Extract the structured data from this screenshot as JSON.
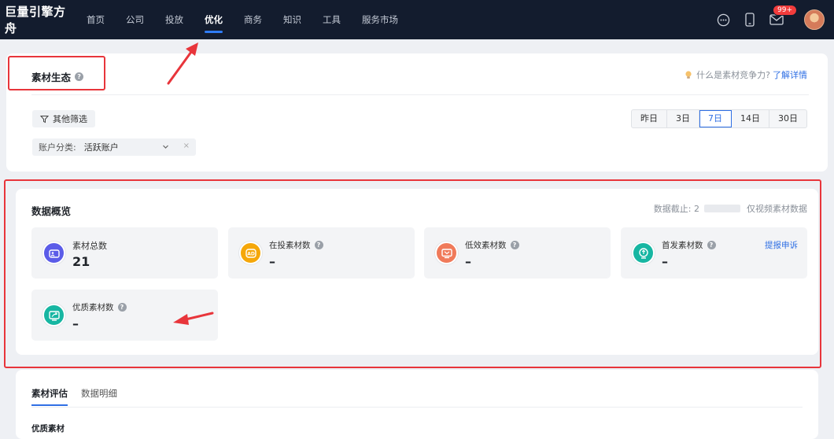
{
  "nav": {
    "brand": "巨量引擎方舟",
    "items": [
      {
        "label": "首页",
        "active": false
      },
      {
        "label": "公司",
        "active": false
      },
      {
        "label": "投放",
        "active": false
      },
      {
        "label": "优化",
        "active": true
      },
      {
        "label": "商务",
        "active": false
      },
      {
        "label": "知识",
        "active": false
      },
      {
        "label": "工具",
        "active": false
      },
      {
        "label": "服务市场",
        "active": false
      }
    ],
    "badge": "99+"
  },
  "ecology": {
    "title": "素材生态",
    "help_text": "什么是素材竞争力?",
    "help_link": "了解详情",
    "filter_button": "其他筛选",
    "account_label": "账户分类:",
    "account_value": "活跃账户",
    "clear": "×",
    "date_ranges": [
      "昨日",
      "3日",
      "7日",
      "14日",
      "30日"
    ],
    "active_range": "7日"
  },
  "overview": {
    "title": "数据概览",
    "cutoff_label": "数据截止: 2",
    "note": "仅视频素材数据",
    "stats": [
      {
        "name": "素材总数",
        "value": "21",
        "icon": "material-total-icon",
        "color": "#5b5ce8"
      },
      {
        "name": "在投素材数",
        "value": "–",
        "icon": "ad-icon",
        "color": "#f5a70a"
      },
      {
        "name": "低效素材数",
        "value": "–",
        "icon": "low-efficiency-icon",
        "color": "#f07a5a"
      },
      {
        "name": "首发素材数",
        "value": "–",
        "icon": "first-release-icon",
        "color": "#17b6a2",
        "link": "提报申诉"
      },
      {
        "name": "优质素材数",
        "value": "–",
        "icon": "quality-icon",
        "color": "#17b6a2"
      }
    ]
  },
  "bottom": {
    "tabs": [
      "素材评估",
      "数据明细"
    ],
    "active_tab": "素材评估",
    "section_title": "优质素材"
  },
  "colors": {
    "accent": "#2f6fe4",
    "nav_bg": "#131c2e",
    "annotation": "#e8353b"
  }
}
